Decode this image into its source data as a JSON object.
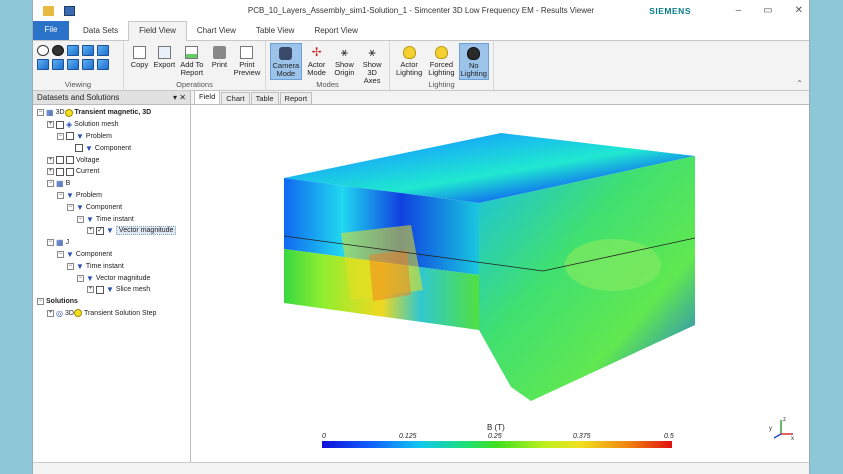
{
  "window": {
    "title": "PCB_10_Layers_Assembly_sim1-Solution_1 - Simcenter 3D Low Frequency EM - Results Viewer",
    "brand": "SIEMENS",
    "controls": [
      "–",
      "▭",
      "✕"
    ]
  },
  "ribbon_tabs": [
    "File",
    "Data Sets",
    "Field View",
    "Chart View",
    "Table View",
    "Report View"
  ],
  "ribbon": {
    "groups": {
      "viewing": "Viewing",
      "operations": "Operations",
      "modes": "Modes",
      "lighting": "Lighting"
    },
    "operations_buttons": [
      "Copy",
      "Export",
      "Add To\nReport",
      "Print",
      "Print\nPreview"
    ],
    "mode_buttons": [
      "Camera\nMode",
      "Actor\nMode",
      "Show\nOrigin",
      "Show\n3D Axes"
    ],
    "lighting_buttons": [
      "Actor\nLighting",
      "Forced\nLighting",
      "No\nLighting"
    ]
  },
  "panel": {
    "title": "Datasets and Solutions",
    "pin": "▾ ✕"
  },
  "tree": {
    "root": "Transient magnetic, 3D",
    "solution_mesh": "Solution mesh",
    "problem": "Problem",
    "component": "Component",
    "voltage": "Voltage",
    "current": "Current",
    "b": "B",
    "time_instant": "Time instant",
    "vector_magnitude": "Vector magnitude",
    "j": "J",
    "slice_mesh": "Slice mesh",
    "solutions": "Solutions",
    "transient_step": "Transient Solution Step",
    "tag_3d": "3D"
  },
  "view_tabs": [
    "Field",
    "Chart",
    "Table",
    "Report"
  ],
  "legend": {
    "title": "B (T)",
    "ticks": [
      "0",
      "0.125",
      "0.25",
      "0.375",
      "0.5"
    ]
  },
  "axis_labels": {
    "z": "z",
    "y": "y",
    "x": "x"
  },
  "colors": {
    "accent": "#2a73c9",
    "brand": "#0a7d8c",
    "selected_button": "#9cc4ea"
  }
}
